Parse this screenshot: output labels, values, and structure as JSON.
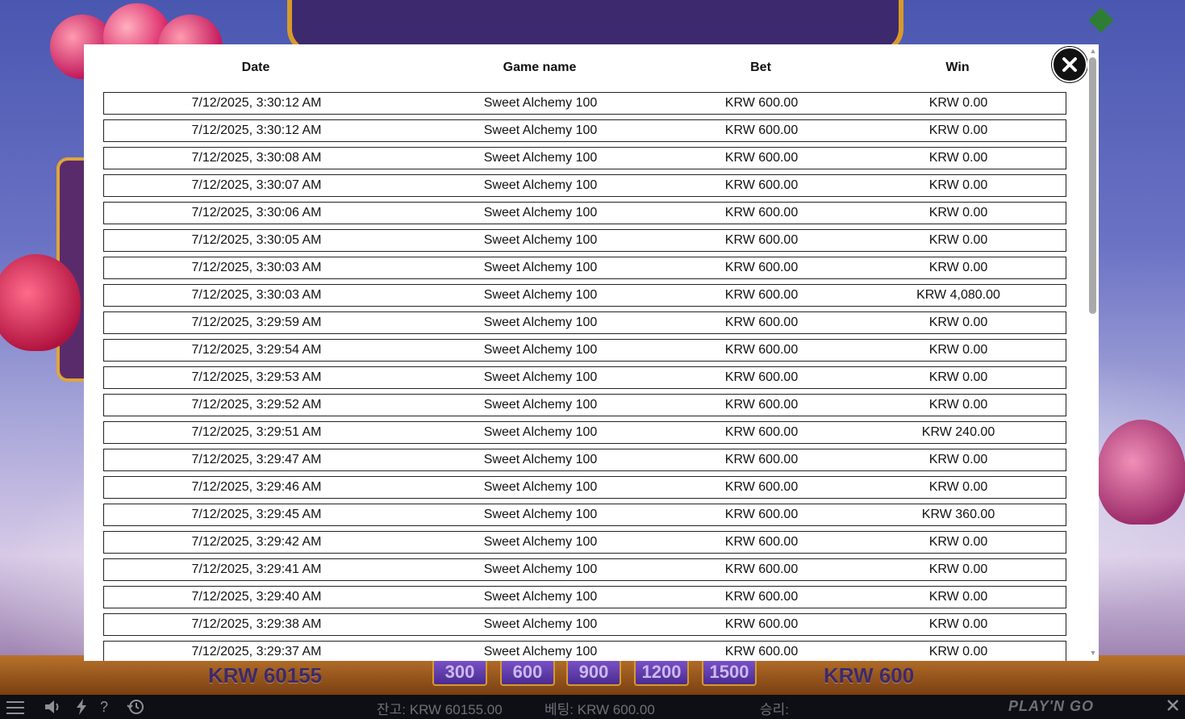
{
  "game": {
    "balance_display": "KRW 60155",
    "bet_display": "KRW 600",
    "bet_chips": [
      "300",
      "600",
      "900",
      "1200",
      "1500"
    ]
  },
  "status_bar": {
    "balance": "잔고: KRW 60155.00",
    "bet": "베팅: KRW 600.00",
    "win": "승리:",
    "brand": "PLAY'N GO",
    "icons": [
      "menu-icon",
      "sound-icon",
      "lightning-icon",
      "help-icon",
      "history-icon",
      "close-icon"
    ]
  },
  "history": {
    "columns": {
      "date": "Date",
      "game": "Game name",
      "bet": "Bet",
      "win": "Win"
    },
    "rows": [
      {
        "date": "7/12/2025, 3:30:12 AM",
        "game": "Sweet Alchemy 100",
        "bet": "KRW 600.00",
        "win": "KRW 0.00"
      },
      {
        "date": "7/12/2025, 3:30:12 AM",
        "game": "Sweet Alchemy 100",
        "bet": "KRW 600.00",
        "win": "KRW 0.00"
      },
      {
        "date": "7/12/2025, 3:30:08 AM",
        "game": "Sweet Alchemy 100",
        "bet": "KRW 600.00",
        "win": "KRW 0.00"
      },
      {
        "date": "7/12/2025, 3:30:07 AM",
        "game": "Sweet Alchemy 100",
        "bet": "KRW 600.00",
        "win": "KRW 0.00"
      },
      {
        "date": "7/12/2025, 3:30:06 AM",
        "game": "Sweet Alchemy 100",
        "bet": "KRW 600.00",
        "win": "KRW 0.00"
      },
      {
        "date": "7/12/2025, 3:30:05 AM",
        "game": "Sweet Alchemy 100",
        "bet": "KRW 600.00",
        "win": "KRW 0.00"
      },
      {
        "date": "7/12/2025, 3:30:03 AM",
        "game": "Sweet Alchemy 100",
        "bet": "KRW 600.00",
        "win": "KRW 0.00"
      },
      {
        "date": "7/12/2025, 3:30:03 AM",
        "game": "Sweet Alchemy 100",
        "bet": "KRW 600.00",
        "win": "KRW 4,080.00"
      },
      {
        "date": "7/12/2025, 3:29:59 AM",
        "game": "Sweet Alchemy 100",
        "bet": "KRW 600.00",
        "win": "KRW 0.00"
      },
      {
        "date": "7/12/2025, 3:29:54 AM",
        "game": "Sweet Alchemy 100",
        "bet": "KRW 600.00",
        "win": "KRW 0.00"
      },
      {
        "date": "7/12/2025, 3:29:53 AM",
        "game": "Sweet Alchemy 100",
        "bet": "KRW 600.00",
        "win": "KRW 0.00"
      },
      {
        "date": "7/12/2025, 3:29:52 AM",
        "game": "Sweet Alchemy 100",
        "bet": "KRW 600.00",
        "win": "KRW 0.00"
      },
      {
        "date": "7/12/2025, 3:29:51 AM",
        "game": "Sweet Alchemy 100",
        "bet": "KRW 600.00",
        "win": "KRW 240.00"
      },
      {
        "date": "7/12/2025, 3:29:47 AM",
        "game": "Sweet Alchemy 100",
        "bet": "KRW 600.00",
        "win": "KRW 0.00"
      },
      {
        "date": "7/12/2025, 3:29:46 AM",
        "game": "Sweet Alchemy 100",
        "bet": "KRW 600.00",
        "win": "KRW 0.00"
      },
      {
        "date": "7/12/2025, 3:29:45 AM",
        "game": "Sweet Alchemy 100",
        "bet": "KRW 600.00",
        "win": "KRW 360.00"
      },
      {
        "date": "7/12/2025, 3:29:42 AM",
        "game": "Sweet Alchemy 100",
        "bet": "KRW 600.00",
        "win": "KRW 0.00"
      },
      {
        "date": "7/12/2025, 3:29:41 AM",
        "game": "Sweet Alchemy 100",
        "bet": "KRW 600.00",
        "win": "KRW 0.00"
      },
      {
        "date": "7/12/2025, 3:29:40 AM",
        "game": "Sweet Alchemy 100",
        "bet": "KRW 600.00",
        "win": "KRW 0.00"
      },
      {
        "date": "7/12/2025, 3:29:38 AM",
        "game": "Sweet Alchemy 100",
        "bet": "KRW 600.00",
        "win": "KRW 0.00"
      },
      {
        "date": "7/12/2025, 3:29:37 AM",
        "game": "Sweet Alchemy 100",
        "bet": "KRW 600.00",
        "win": "KRW 0.00"
      }
    ],
    "close_icon": "close-icon",
    "scroll_position": 0.0
  }
}
